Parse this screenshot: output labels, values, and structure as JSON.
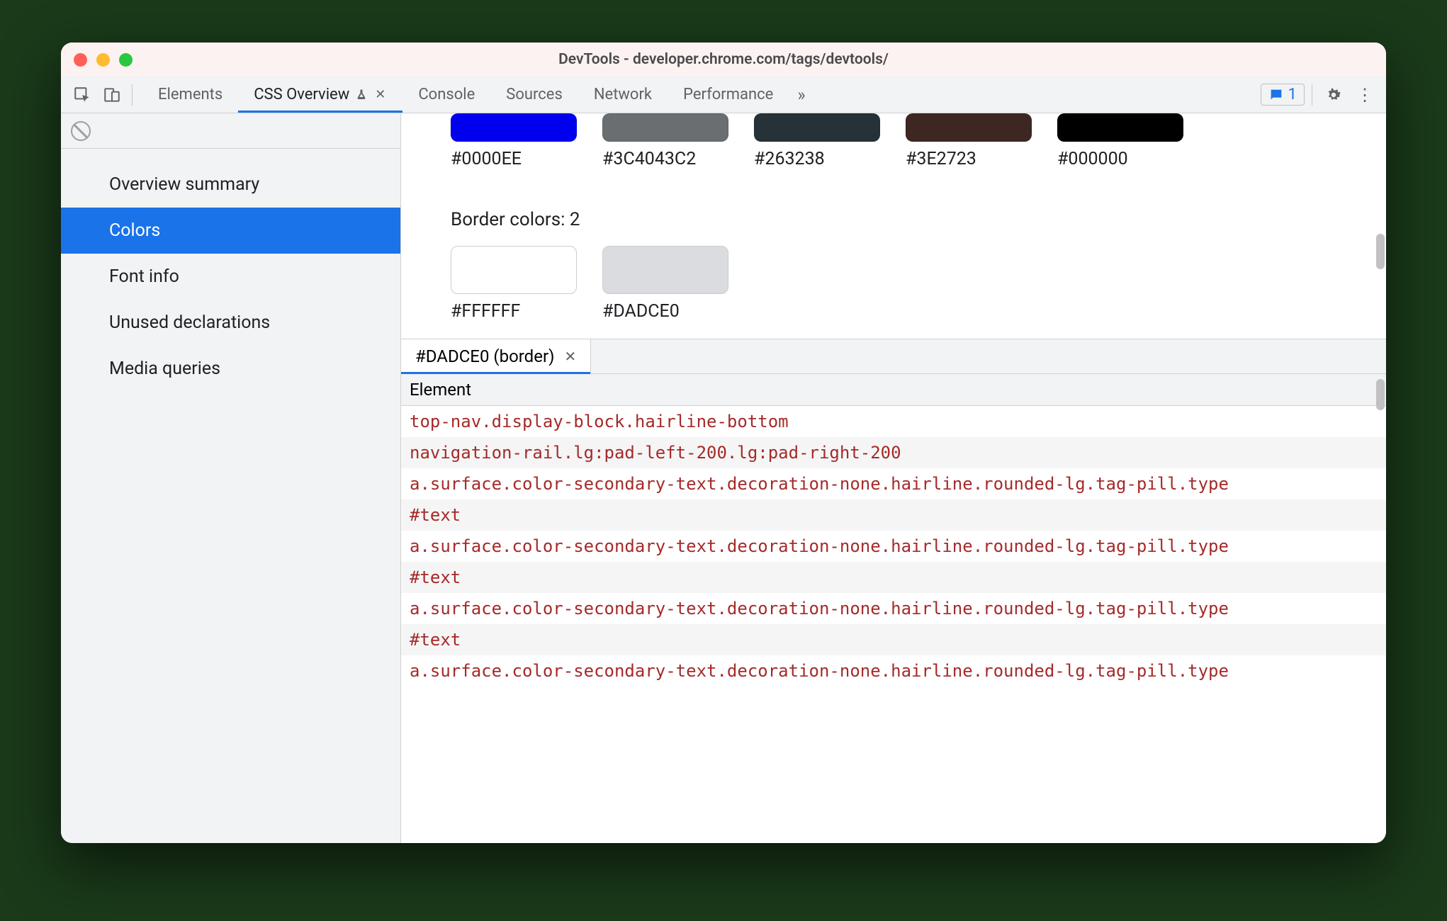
{
  "window": {
    "title": "DevTools - developer.chrome.com/tags/devtools/"
  },
  "tabs": {
    "items": [
      {
        "label": "Elements",
        "active": false
      },
      {
        "label": "CSS Overview",
        "active": true,
        "experimental": true,
        "closable": true
      },
      {
        "label": "Console",
        "active": false
      },
      {
        "label": "Sources",
        "active": false
      },
      {
        "label": "Network",
        "active": false
      },
      {
        "label": "Performance",
        "active": false
      }
    ],
    "more_glyph": "»"
  },
  "issues": {
    "count": "1"
  },
  "sidebar": {
    "items": [
      {
        "label": "Overview summary"
      },
      {
        "label": "Colors"
      },
      {
        "label": "Font info"
      },
      {
        "label": "Unused declarations"
      },
      {
        "label": "Media queries"
      }
    ],
    "active_index": 1
  },
  "swatches_top": [
    {
      "hex": "#0000EE",
      "color": "#0000EE"
    },
    {
      "hex": "#3C4043C2",
      "color": "rgba(60,64,67,0.76)"
    },
    {
      "hex": "#263238",
      "color": "#263238"
    },
    {
      "hex": "#3E2723",
      "color": "#3E2723"
    },
    {
      "hex": "#000000",
      "color": "#000000"
    }
  ],
  "border_section": {
    "title": "Border colors: 2",
    "swatches": [
      {
        "hex": "#FFFFFF",
        "color": "#FFFFFF"
      },
      {
        "hex": "#DADCE0",
        "color": "#DADCE0"
      }
    ]
  },
  "detail": {
    "tab_label": "#DADCE0 (border)",
    "header": "Element",
    "elements": [
      "top-nav.display-block.hairline-bottom",
      "navigation-rail.lg:pad-left-200.lg:pad-right-200",
      "a.surface.color-secondary-text.decoration-none.hairline.rounded-lg.tag-pill.type",
      "#text",
      "a.surface.color-secondary-text.decoration-none.hairline.rounded-lg.tag-pill.type",
      "#text",
      "a.surface.color-secondary-text.decoration-none.hairline.rounded-lg.tag-pill.type",
      "#text",
      "a.surface.color-secondary-text.decoration-none.hairline.rounded-lg.tag-pill.type"
    ]
  }
}
